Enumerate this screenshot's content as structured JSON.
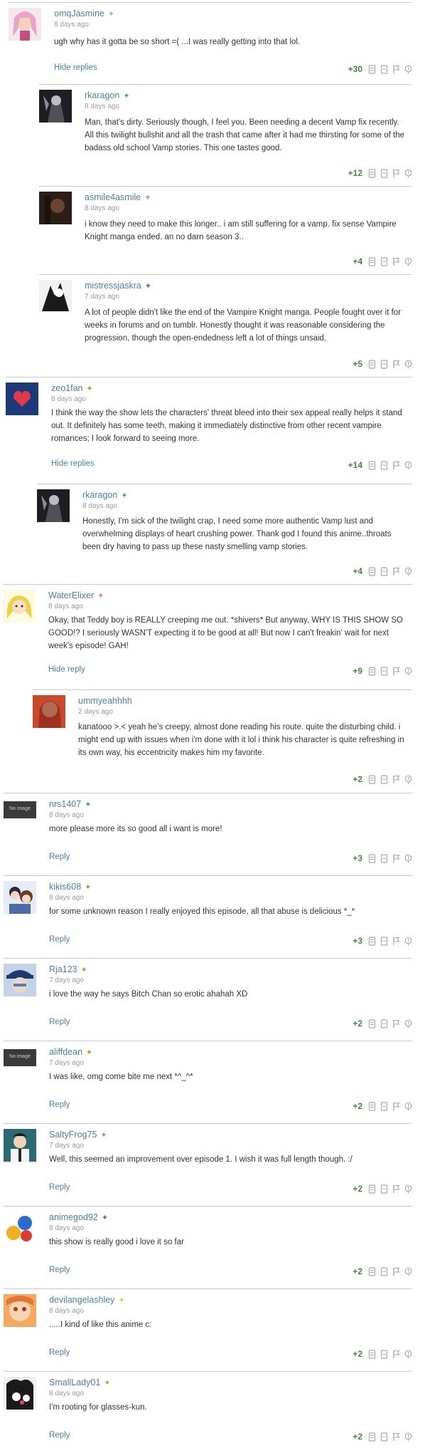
{
  "icons": {
    "upvote": "thumbs-up-icon",
    "downvote": "thumbs-down-icon",
    "flag": "flag-icon",
    "report": "report-icon"
  },
  "colors": {
    "link": "#4a7fa8",
    "score": "#3d8a3d",
    "meta": "#999999",
    "divider": "#c9c9c9"
  },
  "no_image_label": "No image",
  "comments": [
    {
      "user": "omqJasmine",
      "star": "#a0b98a",
      "time": "8 days ago",
      "text": "ugh why has it gotta be so short =( ...I was really getting into that lol.",
      "action": "Hide replies",
      "score": "+30"
    },
    {
      "user": "rkaragon",
      "star": "#3aa88a",
      "time": "8 days ago",
      "text": "Man, that's dirty. Seriously though, I feel you. Been needing a decent Vamp fix recently. All this twilight bullshit and all the trash that came after it had me thirsting for some of the badass old school Vamp stories. This one tastes good.",
      "action": "",
      "score": "+12"
    },
    {
      "user": "asmile4asmile",
      "star": "#e27ac6",
      "time": "8 days ago",
      "text": "i know they need to make this longer.. i am still suffering for a vamp. fix sense Vampire Knight manga ended. an no darn season 3..",
      "action": "",
      "score": "+4"
    },
    {
      "user": "mistressjaskra",
      "star": "#6a5ac8",
      "time": "7 days ago",
      "text": "A lot of people didn't like the end of the Vampire Knight manga. People fought over it for weeks in forums and on tumblr. Honestly thought it was reasonable considering the progression, though the open-endedness left a lot of things unsaid.",
      "action": "",
      "score": "+5"
    },
    {
      "user": "zeo1fan",
      "star": "#d4882c",
      "time": "8 days ago",
      "text": "I think the way the show lets the characters' threat bleed into their sex appeal really helps it stand out. It definitely has some teeth, making it immediately distinctive from other recent vampire romances; I look forward to seeing more.",
      "action": "Hide replies",
      "score": "+14"
    },
    {
      "user": "rkaragon",
      "star": "#3aa88a",
      "time": "8 days ago",
      "text": "Honestly, I'm sick of the twilight crap, I need some more authentic Vamp lust and overwhelming displays of heart crushing power. Thank god I found this anime..throats been dry having to pass up these nasty smelling vamp stories.",
      "action": "",
      "score": "+4"
    },
    {
      "user": "WaterElixer",
      "star": "#e27ac6",
      "time": "8 days ago",
      "text": "Okay, that Teddy boy is REALLY creeping me out. *shivers* But anyway, WHY IS THIS SHOW SO GOOD!? I seriously WASN'T expecting it to be good at all! But now I can't freakin' wait for next week's episode! GAH!",
      "action": "Hide reply",
      "score": "+9"
    },
    {
      "user": "ummyeahhhh",
      "star": "",
      "time": "2 days ago",
      "text": "kanatooo >.< yeah he's creepy, almost done reading his route. quite the disturbing child. i might end up with issues when i'm done with it lol i think his character is quite refreshing in its own way, his eccentricity makes him my favorite.",
      "action": "",
      "score": "+2"
    },
    {
      "user": "nrs1407",
      "star": "#3aa85a",
      "time": "8 days ago",
      "text": "more please more its so good all i want is more!",
      "action": "Reply",
      "score": "+3"
    },
    {
      "user": "kikis608",
      "star": "#d4882c",
      "time": "8 days ago",
      "text": "for some unknown reason I really enjoyed this episode, all that abuse is delicious *_*",
      "action": "Reply",
      "score": "+3"
    },
    {
      "user": "Rja123",
      "star": "#d4882c",
      "time": "7 days ago",
      "text": "i love the way he says Bitch Chan so erotic ahahah XD",
      "action": "Reply",
      "score": "+2"
    },
    {
      "user": "aliffdean",
      "star": "#d4882c",
      "time": "7 days ago",
      "text": "I was like, omg come bite me next *^_^*",
      "action": "Reply",
      "score": "+2"
    },
    {
      "user": "SaltyFrog75",
      "star": "#b87ad4",
      "time": "7 days ago",
      "text": "Well, this seemed an improvement over episode 1. I wish it was full length though. :/",
      "action": "Reply",
      "score": "+2"
    },
    {
      "user": "animegod92",
      "star": "#4a6ac8",
      "time": "8 days ago",
      "text": "this show is really good i love it so far",
      "action": "Reply",
      "score": "+2"
    },
    {
      "user": "devilangelashley",
      "star": "#e8c840",
      "time": "8 days ago",
      "text": ".....I kind of like this anime c:",
      "action": "Reply",
      "score": "+2"
    },
    {
      "user": "SmallLady01",
      "star": "#8ab840",
      "time": "8 days ago",
      "text": "I'm rooting for glasses-kun.",
      "action": "Reply",
      "score": "+2"
    }
  ]
}
